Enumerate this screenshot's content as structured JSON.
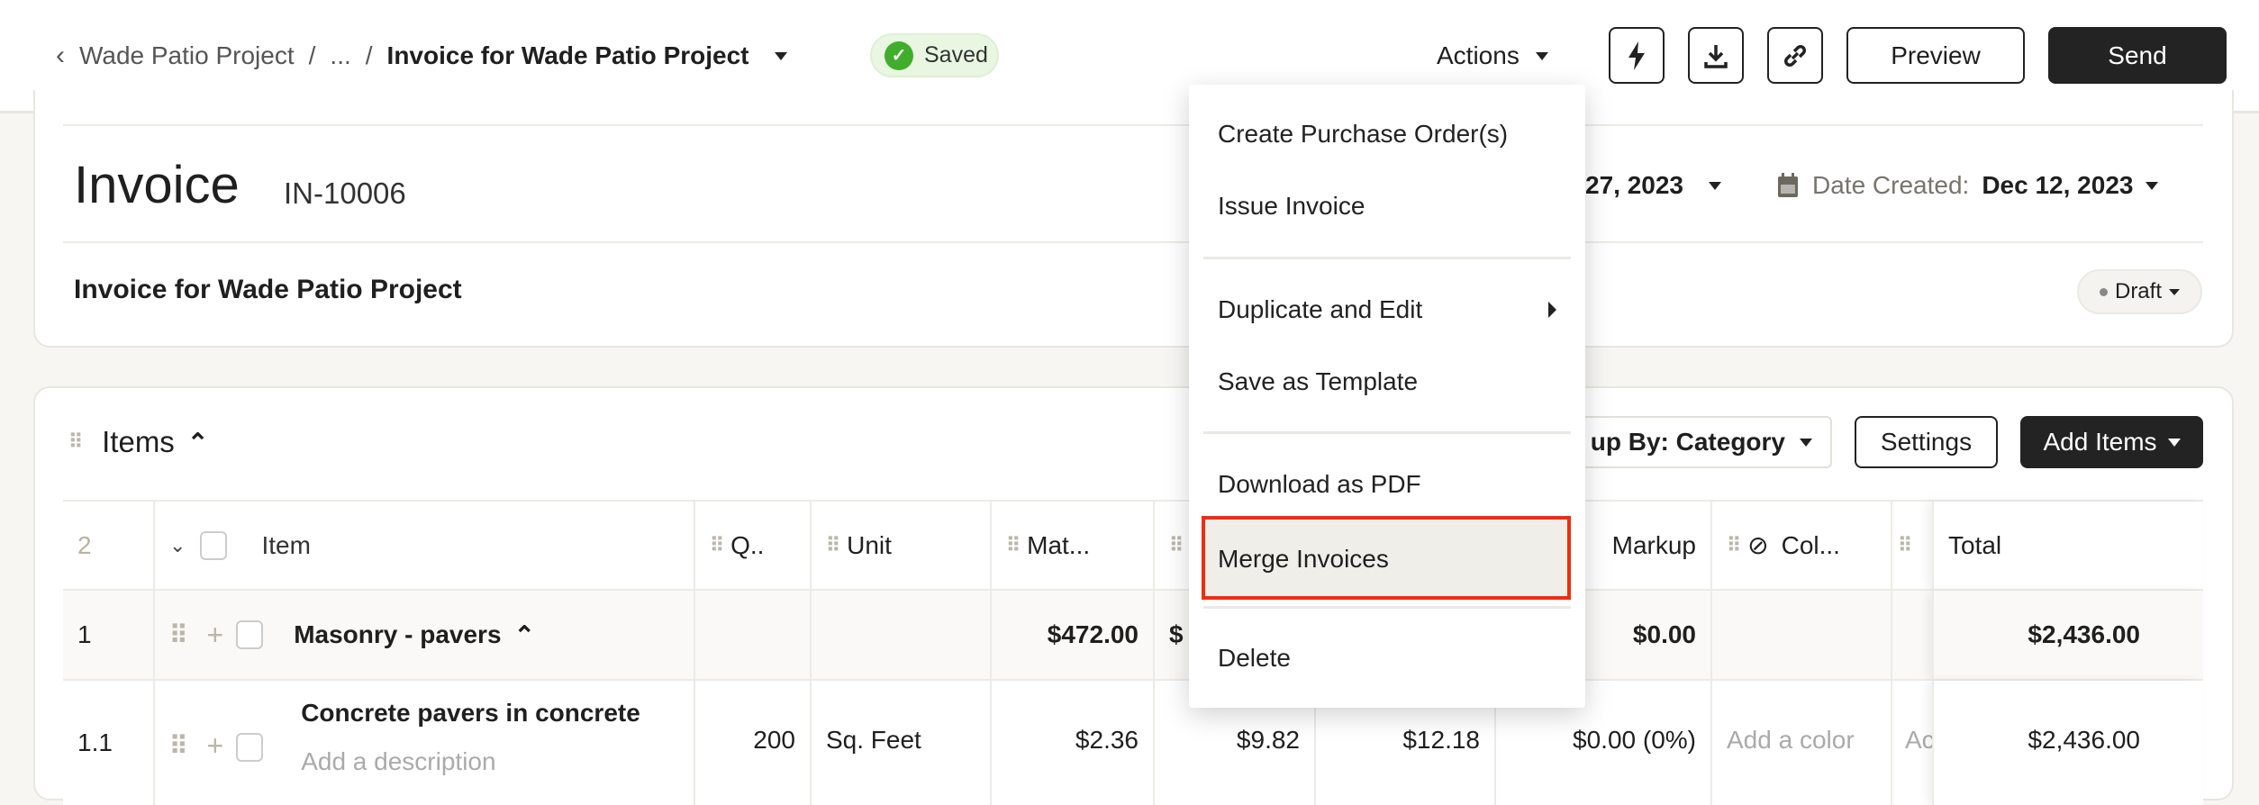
{
  "breadcrumb": {
    "parent": "Wade Patio Project",
    "ellipsis": "...",
    "separator": "/",
    "current": "Invoice for Wade Patio Project"
  },
  "status": {
    "saved": "Saved",
    "color": "#3fae2a"
  },
  "toolbar": {
    "actions": "Actions",
    "preview": "Preview",
    "send": "Send",
    "icons": [
      "lightning-icon",
      "download-icon",
      "link-icon"
    ]
  },
  "invoice": {
    "title": "Invoice",
    "number": "IN-10006",
    "name": "Invoice for Wade Patio Project",
    "due_date_partial": "27, 2023",
    "date_created_label": "Date Created:",
    "date_created": "Dec 12, 2023",
    "status": "Draft"
  },
  "items": {
    "title": "Items",
    "group_by": "up By: Category",
    "settings": "Settings",
    "add_items": "Add Items",
    "columns": {
      "count": "2",
      "item": "Item",
      "qty": "Q..",
      "unit": "Unit",
      "material": "Mat...",
      "markup": "Markup",
      "color": "Col...",
      "total": "Total"
    },
    "rows": [
      {
        "num": "1",
        "item": "Masonry - pavers",
        "material": "$472.00",
        "col5": "$",
        "markup": "$0.00",
        "total": "$2,436.00"
      },
      {
        "num": "1.1",
        "item": "Concrete pavers in concrete",
        "description_placeholder": "Add a description",
        "qty": "200",
        "unit": "Sq. Feet",
        "material": "$2.36",
        "col5": "$9.82",
        "col6": "$12.18",
        "markup": "$0.00 (0%)",
        "color": "Add a color",
        "col10": "Ac",
        "total": "$2,436.00"
      }
    ]
  },
  "menu": {
    "items": [
      "Create Purchase Order(s)",
      "Issue Invoice",
      "Duplicate and Edit",
      "Save as Template",
      "Download as PDF",
      "Merge Invoices",
      "Delete"
    ],
    "highlight_color": "#f0eee9",
    "highlight_border": "#f02d10"
  },
  "colors": {
    "primary": "#222222",
    "background": "#f7f6f3"
  }
}
